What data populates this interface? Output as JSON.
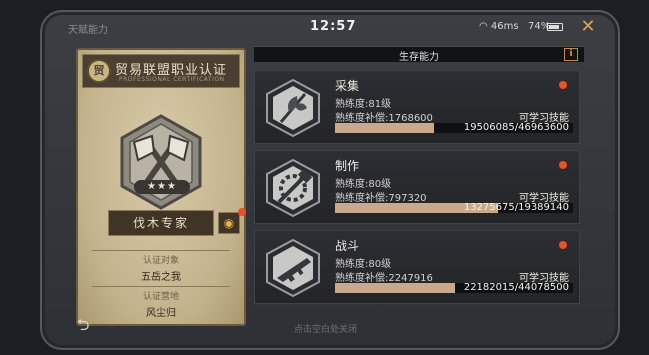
{
  "status": {
    "title": "天赋能力",
    "time": "12:57",
    "wifi": "46ms",
    "battery": "74%"
  },
  "certificate": {
    "badge": "贸",
    "title": "贸易联盟职业认证",
    "subtitle": "PROFESSIONAL CERTIFICATION",
    "stars": "★★★",
    "name": "伐木专家",
    "target_label": "认证对象",
    "target_value": "五岳之我",
    "location_label": "认证营地",
    "location_value": "风尘归"
  },
  "panel": {
    "tab_title": "生存能力",
    "info_label": "i"
  },
  "skills": [
    {
      "name": "采集",
      "level": "熟练度:81级",
      "compensation": "熟练度补偿:1768600",
      "learn": "可学习技能",
      "progress": "19506085/46963600",
      "fill": 0.415,
      "icon": "leaf-icon"
    },
    {
      "name": "制作",
      "level": "熟练度:80级",
      "compensation": "熟练度补偿:797320",
      "learn": "可学习技能",
      "progress": "13275675/19389140",
      "fill": 0.685,
      "icon": "hammer-gear-icon"
    },
    {
      "name": "战斗",
      "level": "熟练度:80级",
      "compensation": "熟练度补偿:2247916",
      "learn": "可学习技能",
      "progress": "22182015/44078500",
      "fill": 0.503,
      "icon": "gun-icon"
    }
  ],
  "footer": {
    "back": "⮌",
    "hint": "点击空白处关闭"
  },
  "colors": {
    "accent_orange": "#e39f36",
    "alert_red": "#f04e23",
    "bar_fill": "#c9a98c"
  }
}
